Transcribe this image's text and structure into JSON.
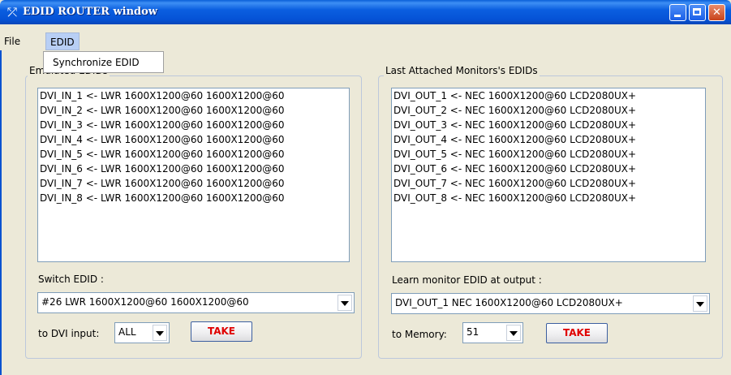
{
  "window": {
    "title": "EDID ROUTER window",
    "icon": "router-icon"
  },
  "menubar": {
    "file": "File",
    "edid": "EDID"
  },
  "edid_menu": {
    "items": [
      "Synchronize EDID"
    ]
  },
  "left_panel": {
    "title": "Emulated EDIDs",
    "items": [
      "DVI_IN_1 <-  LWR 1600X1200@60 1600X1200@60",
      "DVI_IN_2 <-  LWR 1600X1200@60 1600X1200@60",
      "DVI_IN_3 <-  LWR 1600X1200@60 1600X1200@60",
      "DVI_IN_4 <-  LWR 1600X1200@60 1600X1200@60",
      "DVI_IN_5 <-  LWR 1600X1200@60 1600X1200@60",
      "DVI_IN_6 <-  LWR 1600X1200@60 1600X1200@60",
      "DVI_IN_7 <-  LWR 1600X1200@60 1600X1200@60",
      "DVI_IN_8 <-  LWR 1600X1200@60 1600X1200@60"
    ],
    "switch_label": "Switch EDID :",
    "switch_value": "#26 LWR 1600X1200@60 1600X1200@60",
    "target_label": "to DVI input:",
    "target_value": "ALL",
    "take_label": "TAKE"
  },
  "right_panel": {
    "title": "Last Attached Monitors's EDIDs",
    "items": [
      "DVI_OUT_1 <-  NEC 1600X1200@60 LCD2080UX+",
      "DVI_OUT_2 <-  NEC 1600X1200@60 LCD2080UX+",
      "DVI_OUT_3 <-  NEC 1600X1200@60 LCD2080UX+",
      "DVI_OUT_4 <-  NEC 1600X1200@60 LCD2080UX+",
      "DVI_OUT_5 <-  NEC 1600X1200@60 LCD2080UX+",
      "DVI_OUT_6 <-  NEC 1600X1200@60 LCD2080UX+",
      "DVI_OUT_7 <-  NEC 1600X1200@60 LCD2080UX+",
      "DVI_OUT_8 <-  NEC 1600X1200@60 LCD2080UX+"
    ],
    "learn_label": "Learn monitor EDID at output :",
    "learn_value": "DVI_OUT_1  NEC 1600X1200@60 LCD2080UX+",
    "memory_label": "to Memory:",
    "memory_value": "51",
    "take_label": "TAKE"
  },
  "colors": {
    "take_text": "#e00000",
    "menu_highlight": "#b8cff5",
    "titlebar": "#0552d6"
  }
}
